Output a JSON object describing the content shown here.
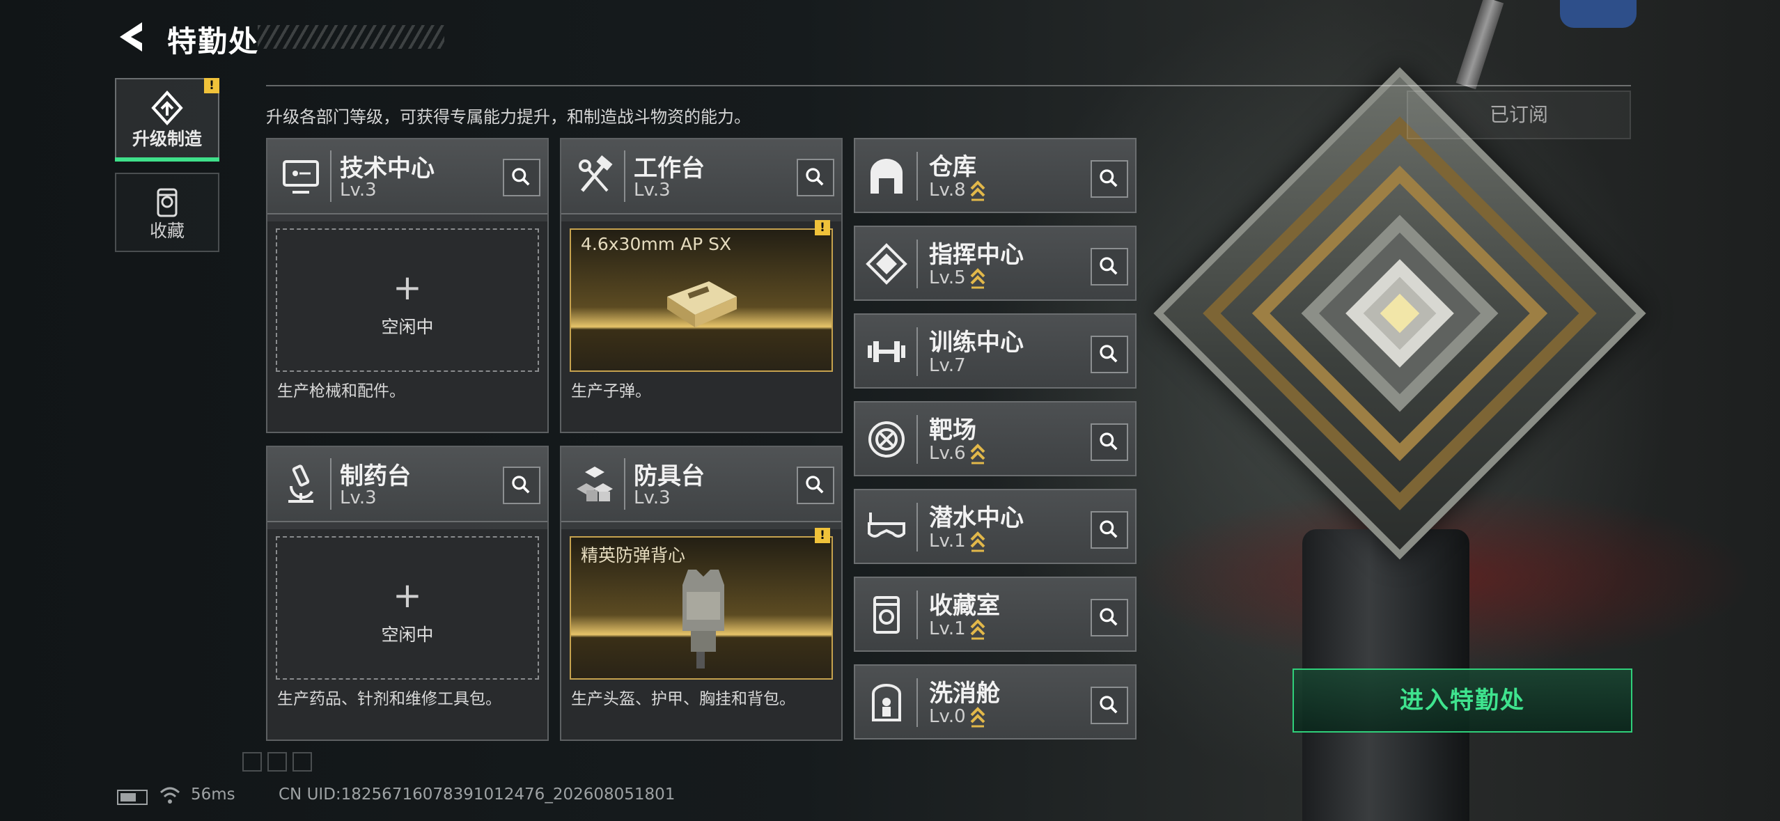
{
  "header": {
    "title": "特勤处"
  },
  "nav": {
    "items": [
      {
        "label": "升级制造",
        "active": true,
        "badge": "!"
      },
      {
        "label": "收藏",
        "active": false
      }
    ]
  },
  "subtitle": "升级各部门等级，可获得专属能力提升，和制造战斗物资的能力。",
  "subscribed_label": "已订阅",
  "workshops": [
    {
      "name": "技术中心",
      "level": "Lv.3",
      "icon": "computer-icon",
      "slot": {
        "state": "empty",
        "text": "空闲中"
      },
      "desc": "生产枪械和配件。"
    },
    {
      "name": "工作台",
      "level": "Lv.3",
      "icon": "tools-icon",
      "slot": {
        "state": "producing",
        "text": "4.6x30mm AP SX",
        "badge": "!"
      },
      "desc": "生产子弹。"
    },
    {
      "name": "制药台",
      "level": "Lv.3",
      "icon": "microscope-icon",
      "slot": {
        "state": "empty",
        "text": "空闲中"
      },
      "desc": "生产药品、针剂和维修工具包。"
    },
    {
      "name": "防具台",
      "level": "Lv.3",
      "icon": "blocks-icon",
      "slot": {
        "state": "producing",
        "text": "精英防弹背心",
        "badge": "!"
      },
      "desc": "生产头盔、护甲、胸挂和背包。"
    }
  ],
  "facilities": [
    {
      "name": "仓库",
      "level": "Lv.8",
      "upgradable": true,
      "icon": "warehouse-icon"
    },
    {
      "name": "指挥中心",
      "level": "Lv.5",
      "upgradable": true,
      "icon": "chip-icon"
    },
    {
      "name": "训练中心",
      "level": "Lv.7",
      "upgradable": false,
      "icon": "dumbbell-icon"
    },
    {
      "name": "靶场",
      "level": "Lv.6",
      "upgradable": true,
      "icon": "target-icon"
    },
    {
      "name": "潜水中心",
      "level": "Lv.1",
      "upgradable": true,
      "icon": "diving-mask-icon"
    },
    {
      "name": "收藏室",
      "level": "Lv.1",
      "upgradable": true,
      "icon": "display-case-icon"
    },
    {
      "name": "洗消舱",
      "level": "Lv.0",
      "upgradable": true,
      "icon": "decon-pod-icon"
    }
  ],
  "enter_button": "进入特勤处",
  "footer": {
    "ping": "56ms",
    "uid": "CN UID:18256716078391012476_202608051801"
  },
  "colors": {
    "accent_green": "#3fe38e",
    "gold": "#e2b84a",
    "badge_yellow": "#f0c23a"
  }
}
